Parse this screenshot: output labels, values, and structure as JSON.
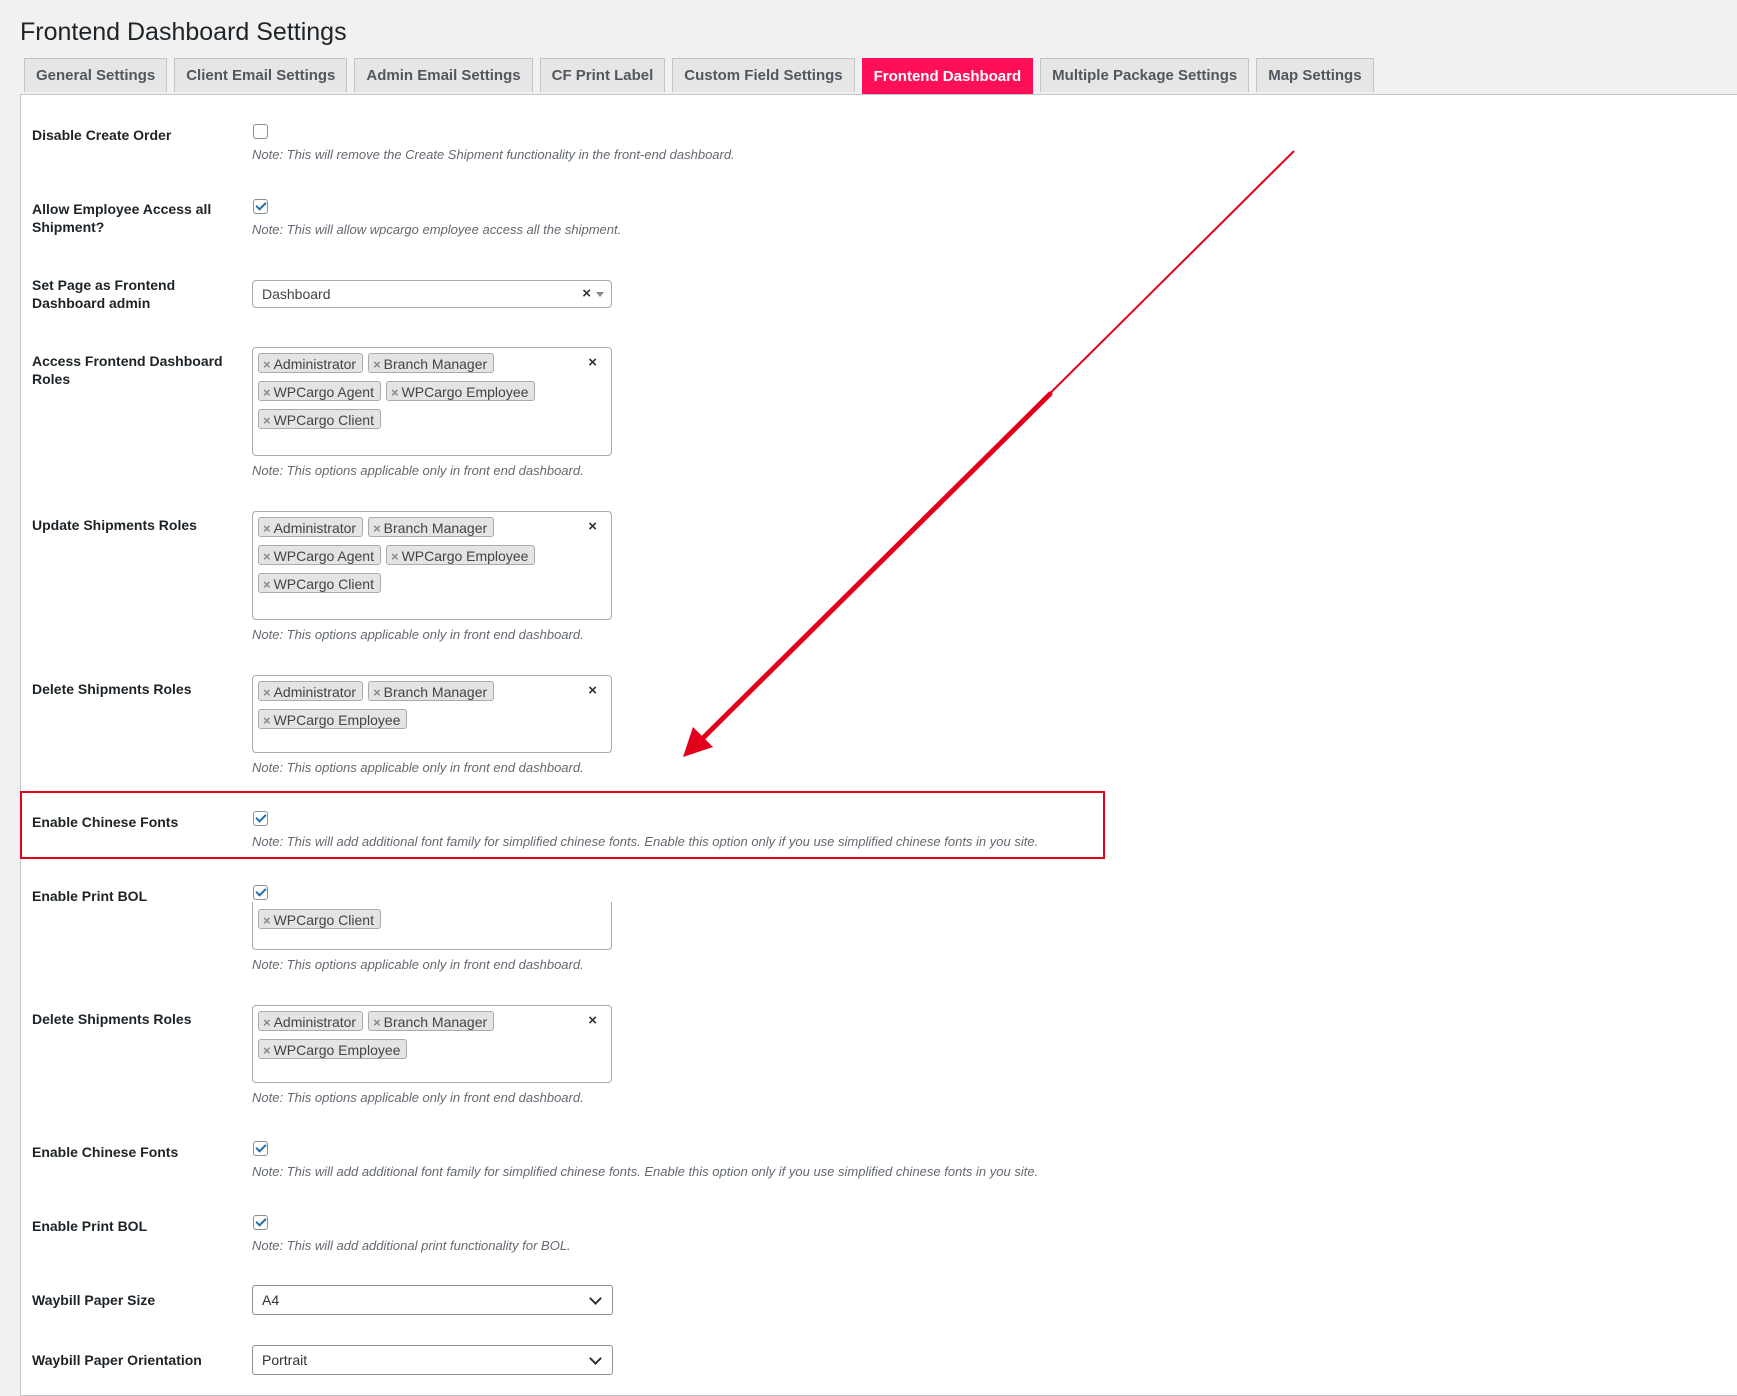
{
  "page": {
    "title": "Frontend Dashboard Settings"
  },
  "tabs": [
    {
      "label": "General Settings",
      "active": false
    },
    {
      "label": "Client Email Settings",
      "active": false
    },
    {
      "label": "Admin Email Settings",
      "active": false
    },
    {
      "label": "CF Print Label",
      "active": false
    },
    {
      "label": "Custom Field Settings",
      "active": false
    },
    {
      "label": "Frontend Dashboard",
      "active": true
    },
    {
      "label": "Multiple Package Settings",
      "active": false
    },
    {
      "label": "Map Settings",
      "active": false
    }
  ],
  "colors": {
    "active_tab": "#ff0f57",
    "annotation": "#e3001b",
    "checkbox_tick": "#2271b1"
  },
  "settings": {
    "disable_create_order": {
      "label": "Disable Create Order",
      "checked": false,
      "note": "Note: This will remove the Create Shipment functionality in the front-end dashboard."
    },
    "allow_employee": {
      "label": "Allow Employee Access all Shipment?",
      "checked": true,
      "note": "Note: This will allow wpcargo employee access all the shipment."
    },
    "set_page": {
      "label": "Set Page as Frontend Dashboard admin",
      "value": "Dashboard",
      "clear": "×"
    },
    "access_roles": {
      "label": "Access Frontend Dashboard Roles",
      "chips": [
        "Administrator",
        "Branch Manager",
        "WPCargo Agent",
        "WPCargo Employee",
        "WPCargo Client"
      ],
      "clear": "×",
      "note": "Note: This options applicable only in front end dashboard."
    },
    "update_roles": {
      "label": "Update Shipments Roles",
      "chips": [
        "Administrator",
        "Branch Manager",
        "WPCargo Agent",
        "WPCargo Employee",
        "WPCargo Client"
      ],
      "clear": "×",
      "note": "Note: This options applicable only in front end dashboard."
    },
    "delete_roles": {
      "label": "Delete Shipments Roles",
      "chips": [
        "Administrator",
        "Branch Manager",
        "WPCargo Employee"
      ],
      "clear": "×",
      "note": "Note: This options applicable only in front end dashboard."
    },
    "chinese_fonts_highlight": {
      "label": "Enable Chinese Fonts",
      "checked": true,
      "note": "Note: This will add additional font family for simplified chinese fonts. Enable this option only if you use simplified chinese fonts in you site."
    },
    "print_bol_partial": {
      "label": "Enable Print BOL",
      "checked": true,
      "chips": [
        "WPCargo Client"
      ],
      "note": "Note: This options applicable only in front end dashboard."
    },
    "delete_roles_2": {
      "label": "Delete Shipments Roles",
      "chips": [
        "Administrator",
        "Branch Manager",
        "WPCargo Employee"
      ],
      "clear": "×",
      "note": "Note: This options applicable only in front end dashboard."
    },
    "chinese_fonts": {
      "label": "Enable Chinese Fonts",
      "checked": true,
      "note": "Note: This will add additional font family for simplified chinese fonts. Enable this option only if you use simplified chinese fonts in you site."
    },
    "print_bol": {
      "label": "Enable Print BOL",
      "checked": true,
      "note": "Note: This will add additional print functionality for BOL."
    },
    "paper_size": {
      "label": "Waybill Paper Size",
      "value": "A4"
    },
    "paper_orientation": {
      "label": "Waybill Paper Orientation",
      "value": "Portrait"
    }
  },
  "chip_remove": "×"
}
